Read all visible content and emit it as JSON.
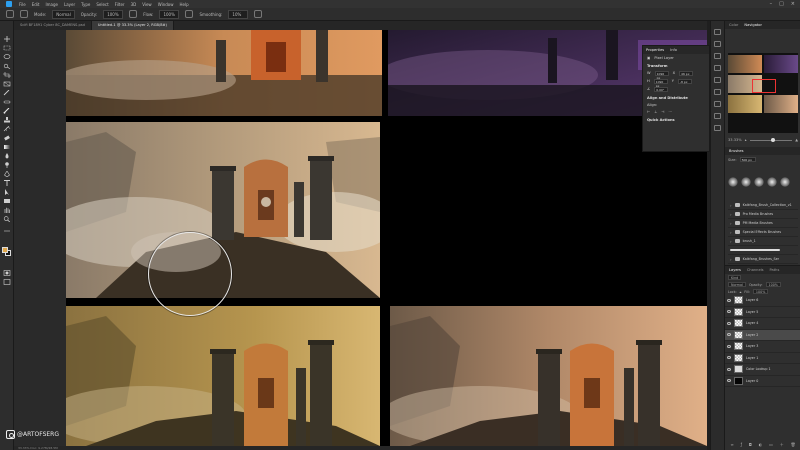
{
  "menubar": {
    "items": [
      "File",
      "Edit",
      "Image",
      "Layer",
      "Type",
      "Select",
      "Filter",
      "3D",
      "View",
      "Window",
      "Help"
    ]
  },
  "optbar": {
    "mode_label": "Mode:",
    "mode_value": "Normal",
    "opacity_label": "Opacity:",
    "opacity_value": "100%",
    "flow_label": "Flow:",
    "flow_value": "100%",
    "smoothing_label": "Smoothing:",
    "smoothing_value": "10%"
  },
  "tabs": [
    {
      "label": "Scifi BF1891 Cyber 8C_DAMENS.psd",
      "active": false
    },
    {
      "label": "Untitled-1 @ 33.3% (Layer 2, RGB/8#)",
      "active": true
    }
  ],
  "status": {
    "zoom": "33.33%",
    "doc_info": "Doc: 9.27M/28.5M"
  },
  "watermark": {
    "handle": "@ARTOFSERG"
  },
  "properties": {
    "tabs": [
      "Properties",
      "Info"
    ],
    "doc_label": "Pixel Layer",
    "transform_label": "Transform",
    "w_value": "1096 px",
    "h_value": "1090 px",
    "x_value": "46 px",
    "y_value": "-8 px",
    "angle_value": "0.00°",
    "align_label": "Align and Distribute",
    "align_sub": "Align:",
    "quick_actions_label": "Quick Actions"
  },
  "right_panel": {
    "nav_tabs": [
      "Color",
      "Navigator"
    ],
    "zoom_value": "33.33%",
    "brushes_title": "Brushes",
    "size_label": "Size:",
    "size_value": "500 px",
    "brush_folders": [
      "Kaikfang_Brush_Collection_v1",
      "Pro Media Brushes",
      "PM Media Brushes",
      "Special Effects Brushes",
      "brush_1",
      "",
      "Kaikfang_Brushes_Ser",
      "inspiration"
    ],
    "layers_tabs": [
      "Layers",
      "Channels",
      "Paths"
    ],
    "kind_label": "Kind",
    "blend_value": "Normal",
    "opacity_label": "Opacity:",
    "opacity_value": "100%",
    "lock_label": "Lock:",
    "fill_label": "Fill:",
    "fill_value": "100%",
    "layers": [
      {
        "name": "Layer 6",
        "thumb": "checker",
        "selected": false
      },
      {
        "name": "Layer 5",
        "thumb": "checker",
        "selected": false
      },
      {
        "name": "Layer 4",
        "thumb": "checker",
        "selected": false
      },
      {
        "name": "Layer 2",
        "thumb": "checker",
        "selected": true
      },
      {
        "name": "Layer 3",
        "thumb": "checker",
        "selected": false
      },
      {
        "name": "Layer 1",
        "thumb": "checker",
        "selected": false
      },
      {
        "name": "Color Lookup 1",
        "thumb": "adj",
        "selected": false
      },
      {
        "name": "Layer 0",
        "thumb": "black",
        "selected": false
      }
    ]
  },
  "colors": {
    "foreground": "#e0a74a",
    "background": "#111111",
    "accent": "#2da0f0"
  }
}
